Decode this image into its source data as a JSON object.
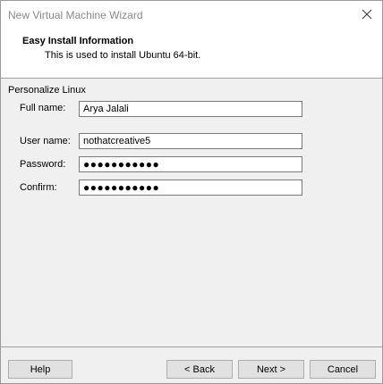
{
  "window": {
    "title": "New Virtual Machine Wizard",
    "close_icon": "close-icon"
  },
  "header": {
    "title": "Easy Install Information",
    "subtitle": "This is used to install Ubuntu 64-bit."
  },
  "personalize": {
    "group_label": "Personalize Linux",
    "full_name": {
      "label": "Full name:",
      "value": "Arya Jalali"
    },
    "user_name": {
      "label": "User name:",
      "value": "nothatcreative5"
    },
    "password": {
      "label": "Password:",
      "value": "●●●●●●●●●●●"
    },
    "confirm": {
      "label": "Confirm:",
      "value": "●●●●●●●●●●●"
    }
  },
  "buttons": {
    "help": "Help",
    "back": "< Back",
    "next": "Next >",
    "cancel": "Cancel"
  }
}
